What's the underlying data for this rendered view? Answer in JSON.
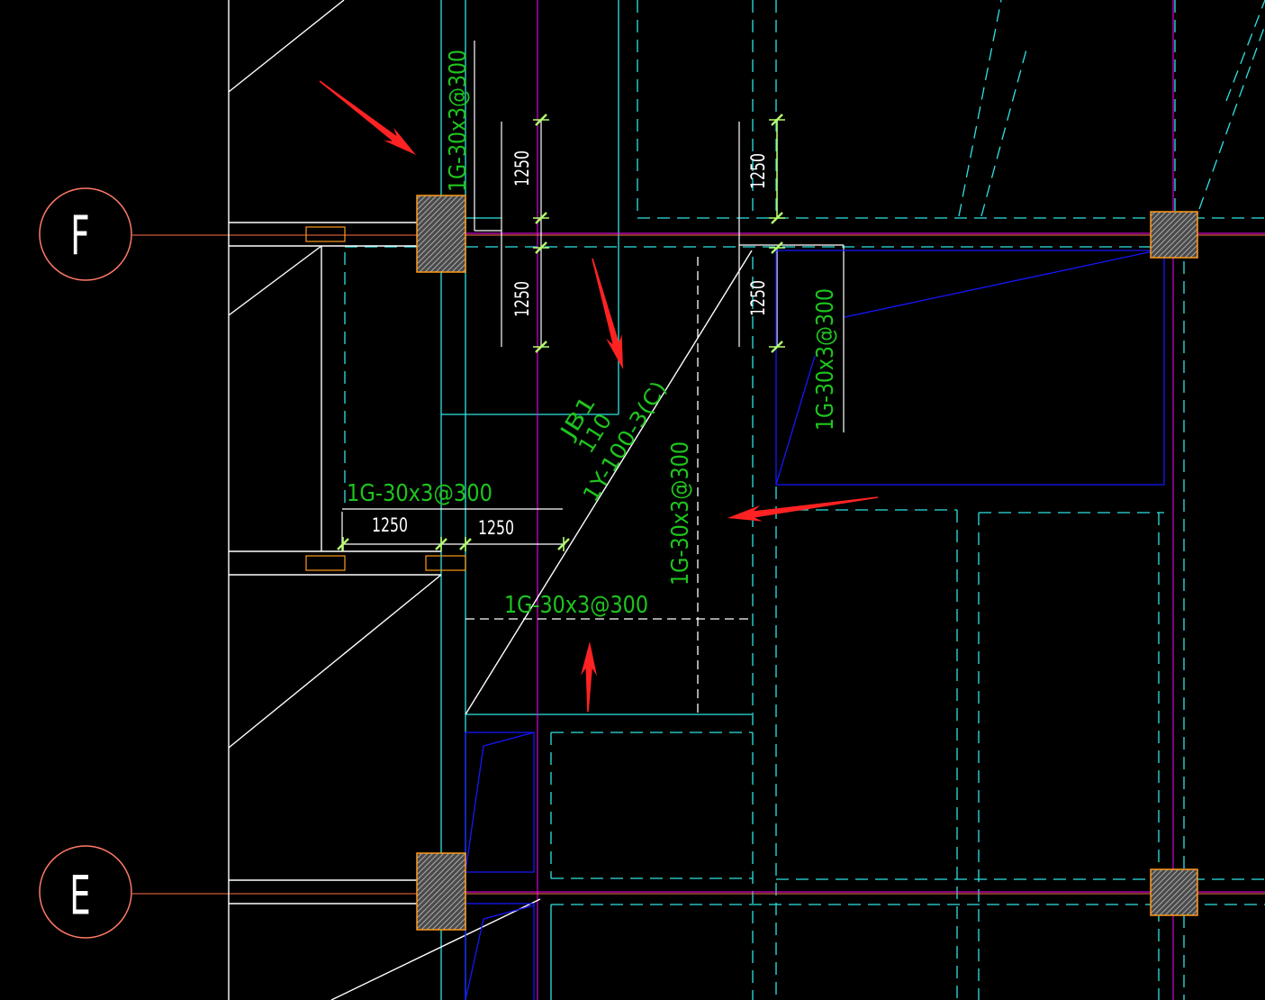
{
  "drawing": {
    "axis_labels": [
      "F",
      "E"
    ],
    "rebar_labels": [
      "1G-30x3@300",
      "1G-30x3@300",
      "1G-30x3@300",
      "1G-30x3@300",
      "1G-30x3@300"
    ],
    "dimensions": [
      "1250",
      "1250",
      "1250",
      "1250",
      "1250",
      "1250"
    ],
    "beam_tag": {
      "name": "JB1",
      "depth": "110",
      "reinforcement": "1Y-100-3(C)"
    }
  },
  "colors": {
    "background": "#000000",
    "wall": "#ffffff",
    "grid": "#2fe3e3",
    "axis": "#ff7048",
    "axis_bubble": "#ff7a66",
    "reference": "#ff00ff",
    "slab_edge": "#1616ff",
    "annotation": "#1fc41f",
    "tick": "#b4ff6e",
    "column": "#ff9a1a",
    "hatch_bg": "#4a4a4a",
    "hatch_line": "#a8a8a8",
    "arrow": "#ff2222"
  }
}
